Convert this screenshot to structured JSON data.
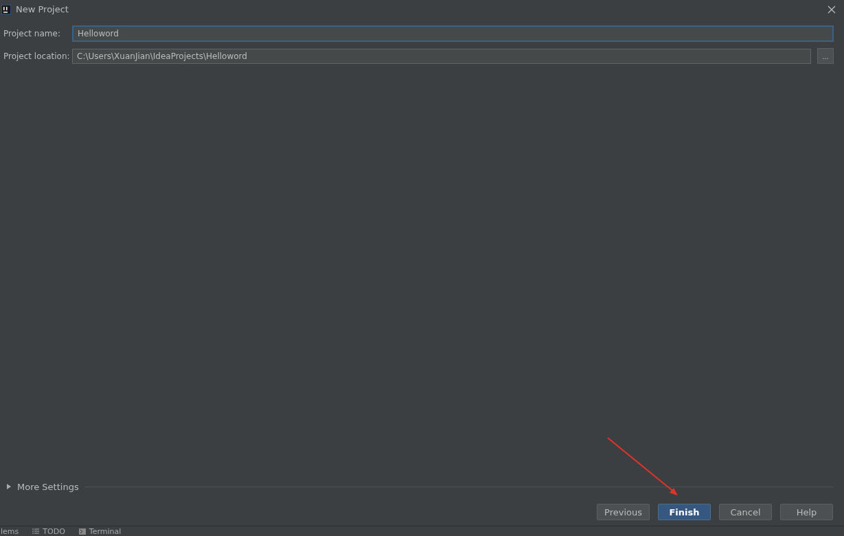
{
  "window": {
    "title": "New Project"
  },
  "fields": [
    {
      "label": "Project name:",
      "value": "Helloword",
      "focused": true
    },
    {
      "label": "Project location:",
      "value": "C:\\Users\\XuanJian\\IdeaProjects\\Helloword",
      "browse": "..."
    }
  ],
  "more_settings": {
    "label": "More Settings",
    "expanded": false
  },
  "buttons": [
    {
      "label": "Previous",
      "default": false
    },
    {
      "label": "Finish",
      "default": true
    },
    {
      "label": "Cancel",
      "default": false
    },
    {
      "label": "Help",
      "default": false
    }
  ],
  "tool_strip": [
    {
      "label": "lems",
      "kind": "plain"
    },
    {
      "label": "TODO",
      "kind": "list"
    },
    {
      "label": "Terminal",
      "kind": "terminal"
    }
  ]
}
